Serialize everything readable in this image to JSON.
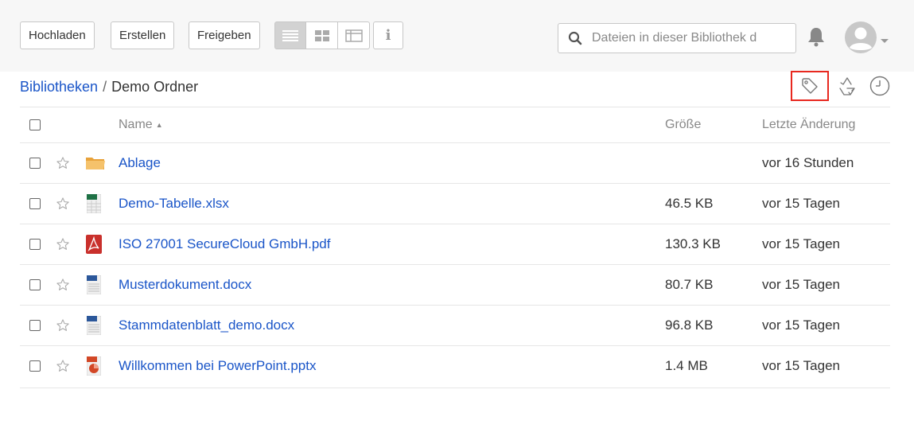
{
  "toolbar": {
    "upload_label": "Hochladen",
    "create_label": "Erstellen",
    "share_label": "Freigeben",
    "info_icon_glyph": "i"
  },
  "search": {
    "placeholder": "Dateien in dieser Bibliothek d"
  },
  "breadcrumb": {
    "root": "Bibliotheken",
    "separator": "/",
    "current": "Demo Ordner"
  },
  "table": {
    "headers": {
      "name": "Name",
      "sort_indicator": "▲",
      "size": "Größe",
      "modified": "Letzte Änderung"
    },
    "rows": [
      {
        "name": "Ablage",
        "size": "",
        "modified": "vor 16 Stunden",
        "icon": "folder-icon"
      },
      {
        "name": "Demo-Tabelle.xlsx",
        "size": "46.5 KB",
        "modified": "vor 15 Tagen",
        "icon": "excel-file-icon"
      },
      {
        "name": "ISO 27001 SecureCloud GmbH.pdf",
        "size": "130.3 KB",
        "modified": "vor 15 Tagen",
        "icon": "pdf-file-icon"
      },
      {
        "name": "Musterdokument.docx",
        "size": "80.7 KB",
        "modified": "vor 15 Tagen",
        "icon": "word-file-icon"
      },
      {
        "name": "Stammdatenblatt_demo.docx",
        "size": "96.8 KB",
        "modified": "vor 15 Tagen",
        "icon": "word-file-icon"
      },
      {
        "name": "Willkommen bei PowerPoint.pptx",
        "size": "1.4 MB",
        "modified": "vor 15 Tagen",
        "icon": "powerpoint-file-icon"
      }
    ]
  },
  "colors": {
    "link": "#1a55c8",
    "highlight_border": "#e8281f",
    "topbar_bg": "#f7f7f7",
    "folder": "#f5b041",
    "excel": "#1e7145",
    "pdf": "#c9302c",
    "word": "#2b579a",
    "powerpoint": "#d24726"
  }
}
